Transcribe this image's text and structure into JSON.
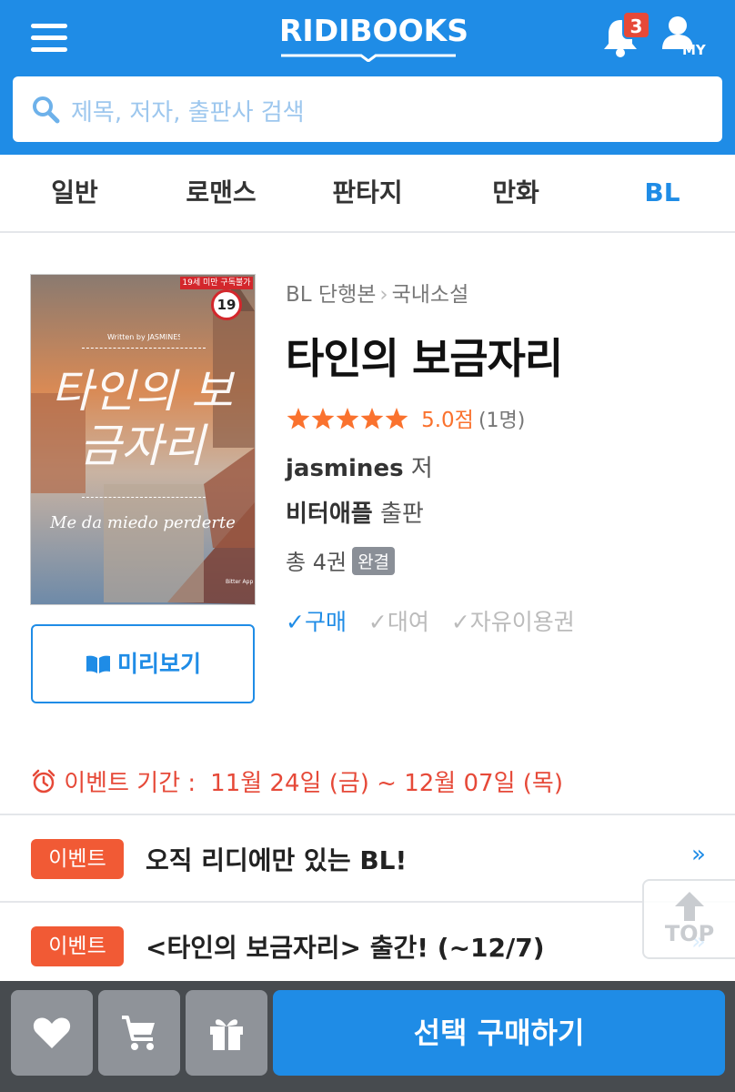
{
  "header": {
    "logo": "RIDIBOOKS",
    "notification_count": "3",
    "my_label": "MY",
    "search_placeholder": "제목, 저자, 출판사 검색"
  },
  "tabs": [
    {
      "label": "일반"
    },
    {
      "label": "로맨스"
    },
    {
      "label": "판타지"
    },
    {
      "label": "만화"
    },
    {
      "label": "BL",
      "active": true
    }
  ],
  "book": {
    "breadcrumb": [
      "BL 단행본",
      "국내소설"
    ],
    "title": "타인의 보금자리",
    "rating_stars": 5,
    "rating_score": "5.0점",
    "rating_count": "(1명)",
    "author": "jasmines",
    "author_role": "저",
    "publisher": "비터애플",
    "publisher_role": "출판",
    "volumes": "총 4권",
    "status": "완결",
    "options": [
      {
        "label": "구매",
        "enabled": true
      },
      {
        "label": "대여",
        "enabled": false
      },
      {
        "label": "자유이용권",
        "enabled": false
      }
    ],
    "preview_label": "미리보기",
    "cover": {
      "age_label": "19세 미만 구독불가",
      "age_badge": "19",
      "written_by": "Written by JASMINES",
      "title_art": "타인의 보금자리",
      "subtitle_art": "Me da miedo perderte",
      "publisher_mark": "Bitter Apple"
    }
  },
  "event_period": {
    "label": "이벤트 기간 :",
    "dates": "11월 24일 (금) ~ 12월 07일 (목)"
  },
  "events": [
    {
      "tag": "이벤트",
      "text": "오직 리디에만 있는 BL!",
      "arrow": "»"
    },
    {
      "tag": "이벤트",
      "text": "<타인의 보금자리> 출간! (~12/7)",
      "arrow": "»"
    }
  ],
  "top_button": "TOP",
  "bottom_bar": {
    "buy_label": "선택 구매하기"
  },
  "colors": {
    "brand": "#1f8ce6",
    "event": "#f15a35",
    "star": "#fa722e"
  }
}
